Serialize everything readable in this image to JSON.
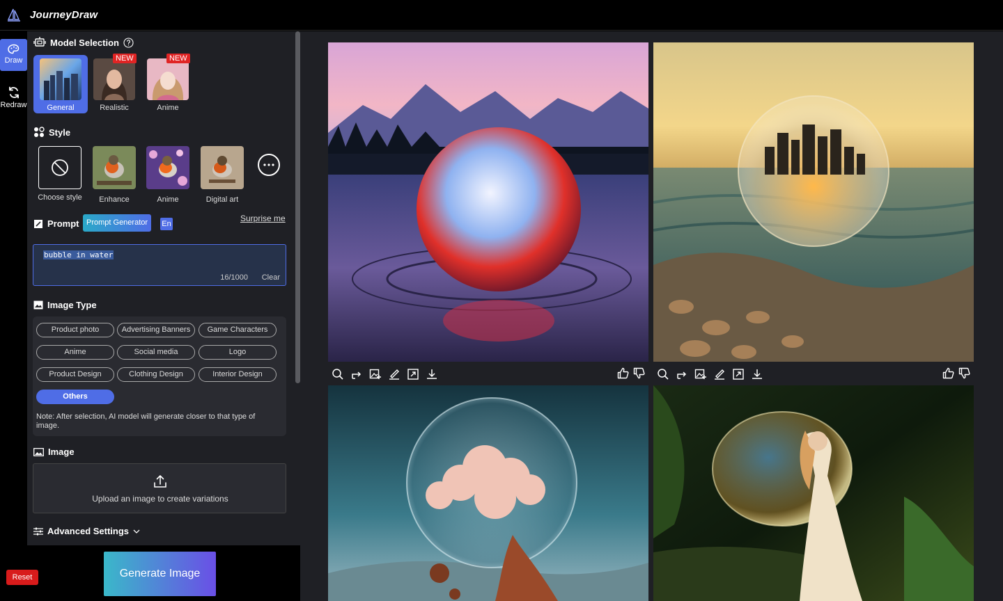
{
  "app": {
    "title": "JourneyDraw"
  },
  "nav": [
    {
      "label": "Draw",
      "icon": "palette-icon"
    },
    {
      "label": "Redraw",
      "icon": "refresh-icon"
    }
  ],
  "model_selection": {
    "title": "Model Selection",
    "models": [
      {
        "label": "General",
        "badge": ""
      },
      {
        "label": "Realistic",
        "badge": "NEW"
      },
      {
        "label": "Anime",
        "badge": "NEW"
      }
    ]
  },
  "style": {
    "title": "Style",
    "items": [
      {
        "label": "Choose style"
      },
      {
        "label": "Enhance"
      },
      {
        "label": "Anime"
      },
      {
        "label": "Digital art"
      }
    ]
  },
  "prompt": {
    "title": "Prompt",
    "generator_label": "Prompt Generator",
    "lang_label": "En",
    "surprise_label": "Surprise me",
    "value": "bubble in water",
    "char_count": "16/1000",
    "clear_label": "Clear"
  },
  "image_type": {
    "title": "Image Type",
    "chips": [
      "Product photo",
      "Advertising Banners",
      "Game Characters",
      "Anime",
      "Social media",
      "Logo",
      "Product Design",
      "Clothing Design",
      "Interior Design",
      "Others"
    ],
    "note": "Note: After selection, AI model will generate closer to that type of image."
  },
  "image": {
    "title": "Image",
    "upload_label": "Upload an image to create variations"
  },
  "advanced": {
    "title": "Advanced Settings"
  },
  "actions": {
    "reset_label": "Reset",
    "generate_label": "Generate Image"
  },
  "colors": {
    "accent": "#4f6de6",
    "panel": "#1f2025",
    "reset": "#d81b1b"
  }
}
